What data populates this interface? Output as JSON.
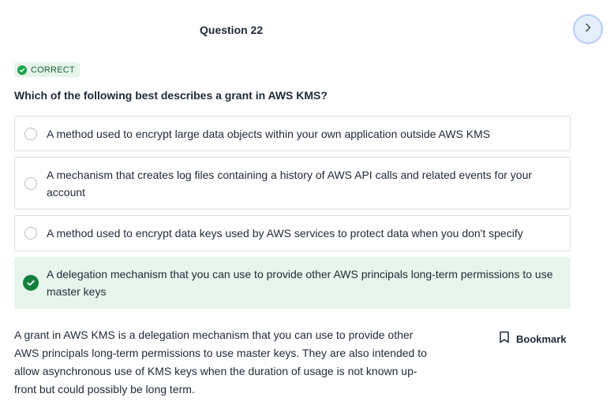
{
  "header": {
    "question_title": "Question 22",
    "next_icon": "chevron-right-icon"
  },
  "status": {
    "label": "CORRECT",
    "icon": "check-circle-icon",
    "color": "#16a34a"
  },
  "question": {
    "prompt": "Which of the following best describes a grant in AWS KMS?",
    "options": [
      {
        "text": "A method used to encrypt large data objects within your own application outside AWS KMS",
        "selected": false
      },
      {
        "text": "A mechanism that creates log files containing a history of AWS API calls and related events for your account",
        "selected": false
      },
      {
        "text": "A method used to encrypt data keys used by AWS services to protect data when you don't specify",
        "selected": false
      },
      {
        "text": "A delegation mechanism that you can use to provide other AWS principals long-term permissions to use master keys",
        "selected": true
      }
    ]
  },
  "explanation": {
    "text": "A grant in AWS KMS is a delegation mechanism that you can use to provide other AWS principals long-term permissions to use master keys. They are also intended to allow asynchronous use of KMS keys when the duration of usage is not known up-front but could possibly be long term."
  },
  "bookmark": {
    "label": "Bookmark",
    "icon": "bookmark-icon"
  },
  "colors": {
    "correct_green": "#15803d",
    "selected_bg": "#e8f5ec",
    "next_button_bg": "#e6eefc"
  }
}
